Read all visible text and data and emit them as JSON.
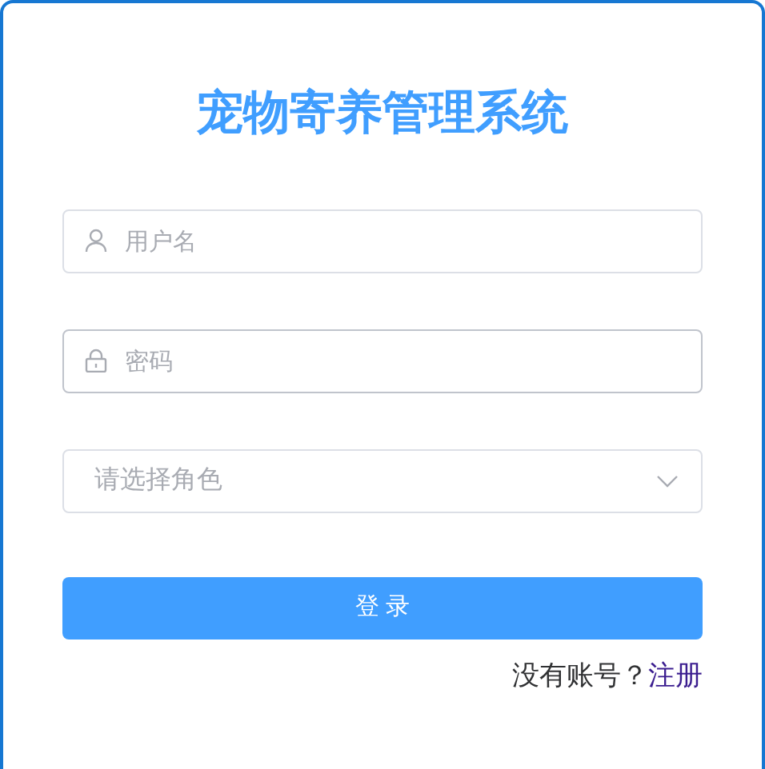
{
  "title": "宠物寄养管理系统",
  "fields": [
    {
      "kind": "text",
      "placeholder": "用户名",
      "hovered": false
    },
    {
      "kind": "password",
      "placeholder": "密码",
      "hovered": true
    },
    {
      "kind": "select",
      "placeholder": "请选择角色",
      "hovered": false
    }
  ],
  "login_button": "登 录",
  "register": {
    "prompt": "没有账号？",
    "link": "注册"
  }
}
